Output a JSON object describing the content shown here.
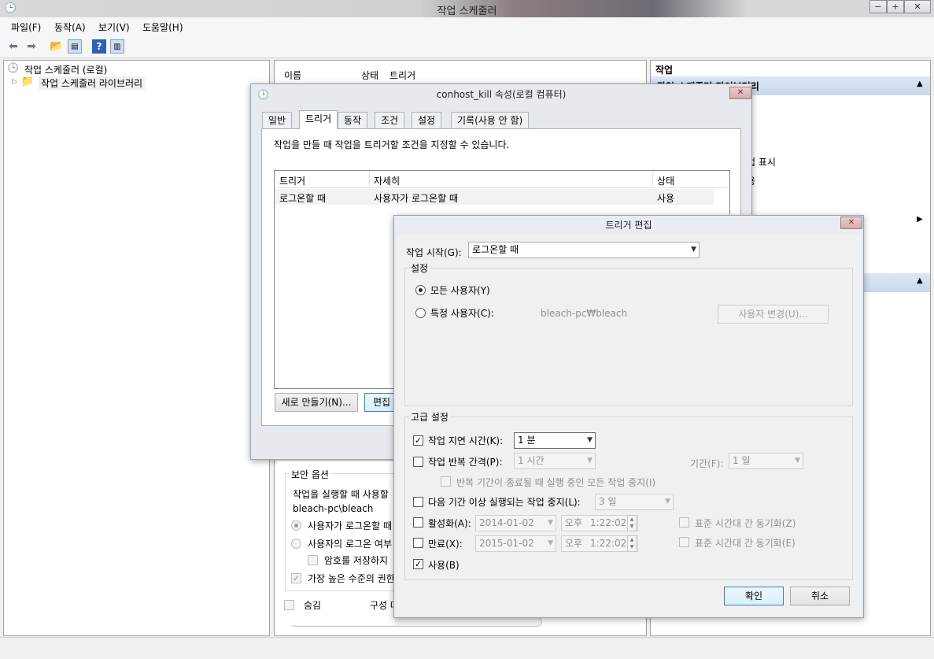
{
  "window": {
    "title": "작업 스케줄러",
    "minimize": "−",
    "maximize": "+",
    "close": "✕"
  },
  "menu": [
    "파일(F)",
    "동작(A)",
    "보기(V)",
    "도움말(H)"
  ],
  "tree": {
    "root": "작업 스케줄러 (로컬)",
    "library": "작업 스케줄러 라이브러리"
  },
  "task_list": {
    "columns": [
      "이름",
      "상태",
      "트리거"
    ]
  },
  "actions_panel": {
    "header": "작업",
    "section1": "작업 스케줄러 라이브러리",
    "item_show": "업 표시",
    "item_use": "용"
  },
  "props_dialog": {
    "title": "conhost_kill 속성(로컬 컴퓨터)",
    "tabs": [
      "일반",
      "트리거",
      "동작",
      "조건",
      "설정",
      "기록(사용 안 함)"
    ],
    "description": "작업을 만들 때 작업을 트리거할 조건을 지정할 수 있습니다.",
    "columns": [
      "트리거",
      "자세히",
      "상태"
    ],
    "rows": [
      {
        "trigger": "로그온할 때",
        "detail": "사용자가 로그온할 때",
        "status": "사용"
      }
    ],
    "new_button": "새로 만들기(N)...",
    "edit_button": "편집"
  },
  "security": {
    "group": "보안 옵션",
    "run_as_label": "작업을 실행할 때 사용할",
    "account": "bleach-pc\\bleach",
    "opt1": "사용자가 로그온할 때",
    "opt2": "사용자의 로그온 여부",
    "no_store_pw": "암호를 저장하지",
    "highest": "가장 높은 수준의 권한",
    "hidden": "숨김",
    "config": "구성 대"
  },
  "trigger_dialog": {
    "title": "트리거 편집",
    "start_label": "작업 시작(G):",
    "start_value": "로그온할 때",
    "settings_group": "설정",
    "any_user": "모든 사용자(Y)",
    "specific_user": "특정 사용자(C):",
    "user_value": "bleach-pc₩bleach",
    "change_user": "사용자 변경(U)...",
    "advanced_group": "고급 설정",
    "delay_label": "작업 지연 시간(K):",
    "delay_value": "1 분",
    "repeat_label": "작업 반복 간격(P):",
    "repeat_value": "1 시간",
    "duration_label": "기간(F):",
    "duration_value": "1 일",
    "stop_repeat": "반복 기간이 종료될 때 실행 중인 모든 작업 중지(I)",
    "stop_long_label": "다음 기간 이상 실행되는 작업 중지(L):",
    "stop_long_value": "3 일",
    "activate_label": "활성화(A):",
    "activate_date": "2014-01-02",
    "activate_ampm": "오후",
    "activate_time": "1:22:02",
    "sync1": "표준 시간대 간 동기화(Z)",
    "expire_label": "만료(X):",
    "expire_date": "2015-01-02",
    "expire_ampm": "오후",
    "expire_time": "1:22:02",
    "sync2": "표준 시간대 간 동기화(E)",
    "enabled_label": "사용(B)",
    "ok": "확인",
    "cancel": "취소"
  }
}
